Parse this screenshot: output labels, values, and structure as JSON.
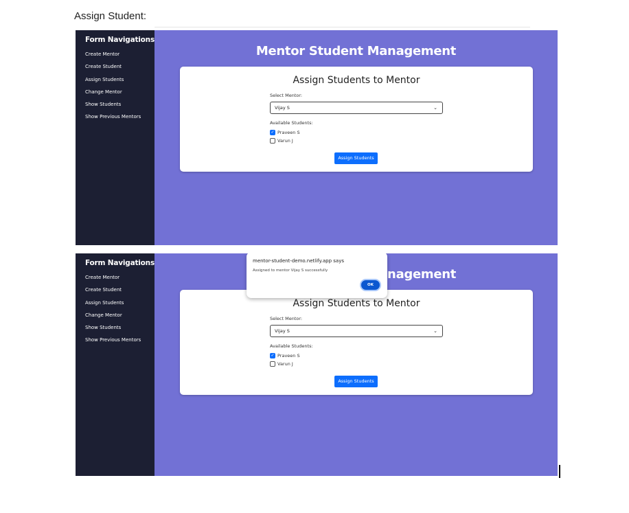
{
  "doc": {
    "heading": "Assign Student:"
  },
  "app": {
    "sidebar_title": "Form Navigations",
    "sidebar_items": [
      "Create Mentor",
      "Create Student",
      "Assign Students",
      "Change Mentor",
      "Show Students",
      "Show Previous Mentors"
    ],
    "main_title": "Mentor Student Management",
    "card_title": "Assign Students to Mentor",
    "select_mentor_label": "Select Mentor:",
    "select_mentor_value": "Vijay S",
    "available_students_label": "Available Students:",
    "students": [
      {
        "name": "Praveen S",
        "checked": true
      },
      {
        "name": "Varun J",
        "checked": false
      }
    ],
    "assign_button": "Assign Students"
  },
  "dialog": {
    "title": "mentor-student-demo.netlify.app says",
    "message": "Assigned to mentor Vijay S successfully",
    "ok_label": "OK"
  },
  "colors": {
    "background": "#7271d5",
    "sidebar": "#1c1f33",
    "button": "#0d6efd",
    "dialog_ok": "#0b57d0"
  }
}
